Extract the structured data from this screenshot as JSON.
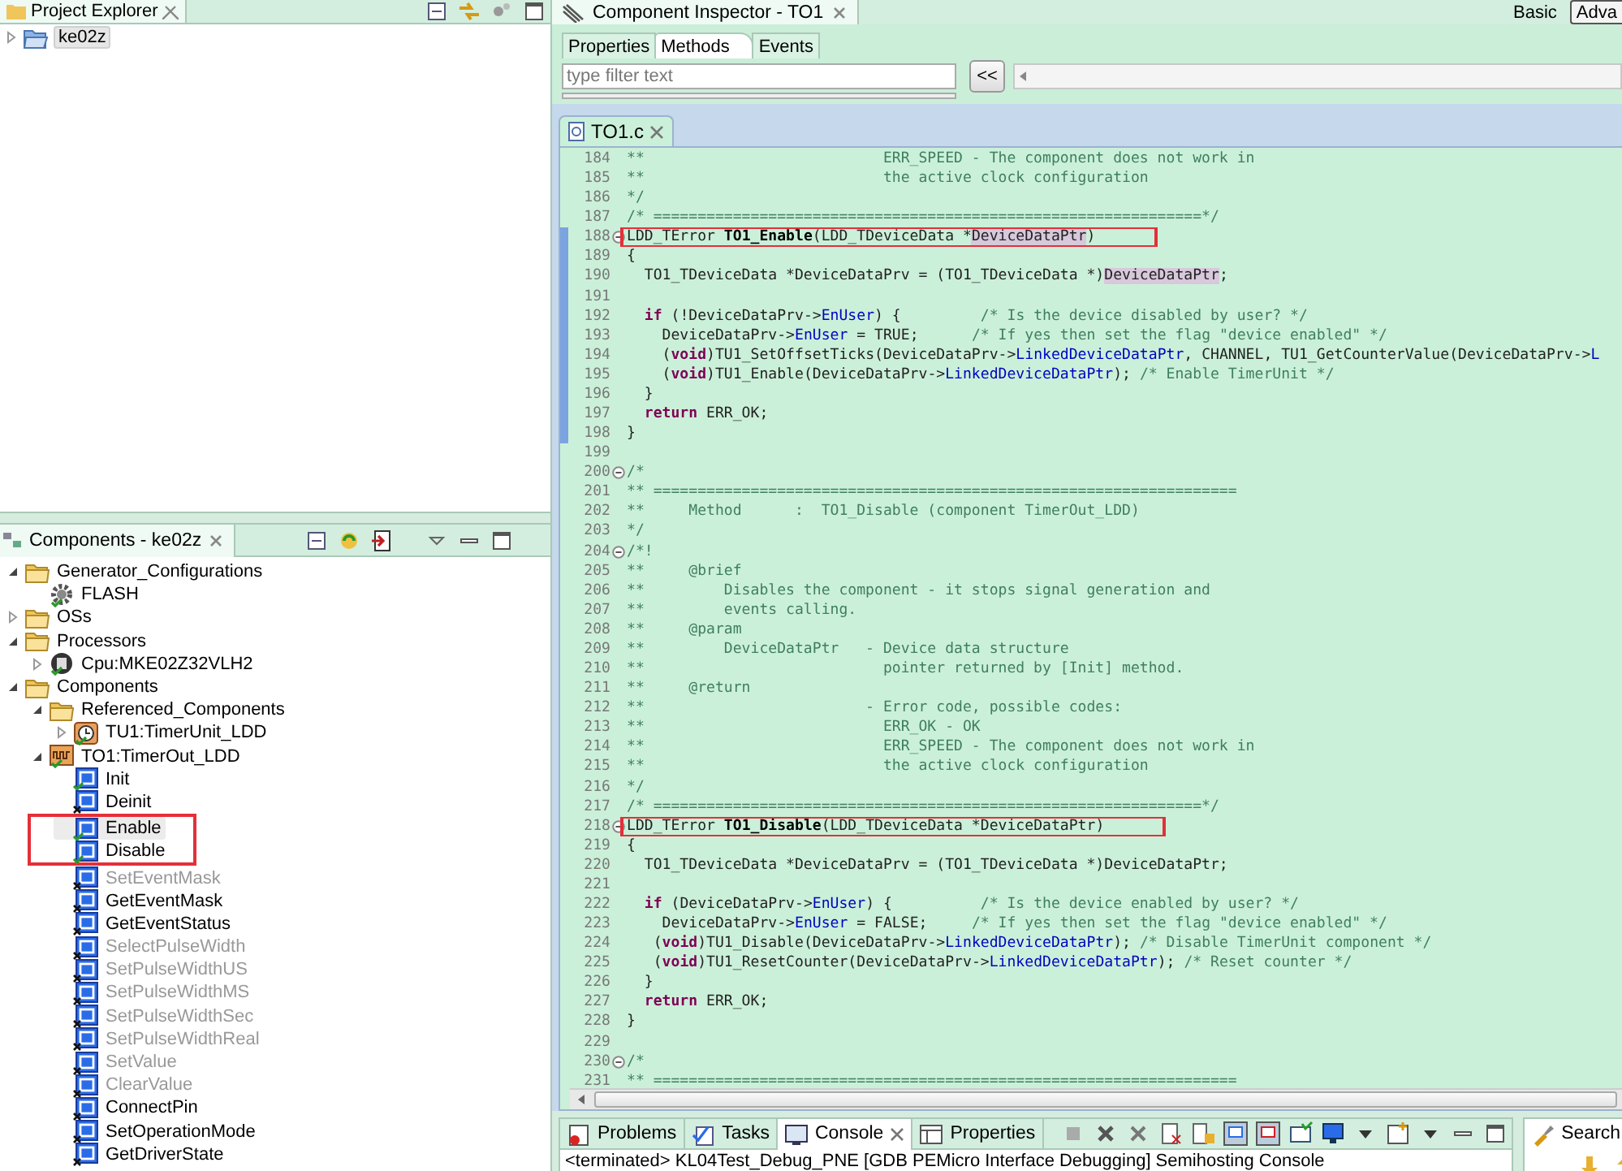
{
  "project_explorer": {
    "title": "Project Explorer",
    "items": [
      {
        "label": "ke02z",
        "kind": "project",
        "expanded": false,
        "selected": true
      }
    ]
  },
  "components": {
    "title": "Components - ke02z",
    "tree": [
      {
        "label": "Generator_Configurations",
        "kind": "folder",
        "expanded": true,
        "selected": false,
        "children": [
          {
            "label": "FLASH",
            "kind": "gear",
            "selected": false
          }
        ]
      },
      {
        "label": "OSs",
        "kind": "folder",
        "expanded": false,
        "selected": false
      },
      {
        "label": "Processors",
        "kind": "folder",
        "expanded": true,
        "selected": false,
        "children": [
          {
            "label": "Cpu:MKE02Z32VLH2",
            "kind": "cpu",
            "expanded": false,
            "selected": false
          }
        ]
      },
      {
        "label": "Components",
        "kind": "folder",
        "expanded": true,
        "selected": false,
        "children": [
          {
            "label": "Referenced_Components",
            "kind": "folder",
            "expanded": true,
            "selected": false,
            "children": [
              {
                "label": "TU1:TimerUnit_LDD",
                "kind": "timer",
                "expanded": false,
                "selected": false
              }
            ]
          },
          {
            "label": "TO1:TimerOut_LDD",
            "kind": "component",
            "expanded": true,
            "selected": false,
            "children": [
              {
                "label": "Init",
                "kind": "method",
                "generated": true,
                "disabled": false,
                "selected": false
              },
              {
                "label": "Deinit",
                "kind": "method",
                "generated": false,
                "disabled": false,
                "selected": false
              },
              {
                "label": "Enable",
                "kind": "method",
                "generated": true,
                "disabled": false,
                "selected": true,
                "marked": true
              },
              {
                "label": "Disable",
                "kind": "method",
                "generated": true,
                "disabled": false,
                "selected": false,
                "marked": true
              },
              {
                "label": "SetEventMask",
                "kind": "method",
                "generated": false,
                "disabled": true,
                "selected": false
              },
              {
                "label": "GetEventMask",
                "kind": "method",
                "generated": false,
                "disabled": false,
                "selected": false
              },
              {
                "label": "GetEventStatus",
                "kind": "method",
                "generated": false,
                "disabled": false,
                "selected": false
              },
              {
                "label": "SelectPulseWidth",
                "kind": "method",
                "generated": false,
                "disabled": true,
                "selected": false
              },
              {
                "label": "SetPulseWidthUS",
                "kind": "method",
                "generated": false,
                "disabled": true,
                "selected": false
              },
              {
                "label": "SetPulseWidthMS",
                "kind": "method",
                "generated": false,
                "disabled": true,
                "selected": false
              },
              {
                "label": "SetPulseWidthSec",
                "kind": "method",
                "generated": false,
                "disabled": true,
                "selected": false
              },
              {
                "label": "SetPulseWidthReal",
                "kind": "method",
                "generated": false,
                "disabled": true,
                "selected": false
              },
              {
                "label": "SetValue",
                "kind": "method",
                "generated": false,
                "disabled": true,
                "selected": false
              },
              {
                "label": "ClearValue",
                "kind": "method",
                "generated": false,
                "disabled": true,
                "selected": false
              },
              {
                "label": "ConnectPin",
                "kind": "method",
                "generated": false,
                "disabled": false,
                "selected": false
              },
              {
                "label": "SetOperationMode",
                "kind": "method",
                "generated": false,
                "disabled": false,
                "selected": false
              },
              {
                "label": "GetDriverState",
                "kind": "method",
                "generated": false,
                "disabled": false,
                "selected": false
              }
            ]
          }
        ]
      }
    ]
  },
  "component_inspector": {
    "title": "Component Inspector - TO1",
    "modes": [
      {
        "label": "Basic",
        "selected": false
      },
      {
        "label": "Adva",
        "selected": true
      }
    ],
    "tabs": [
      {
        "label": "Properties",
        "selected": false
      },
      {
        "label": "Methods",
        "selected": true
      },
      {
        "label": "Events",
        "selected": false
      }
    ],
    "filter": {
      "placeholder": "type filter text"
    },
    "collapse_button": "<<"
  },
  "editor": {
    "tabs": [
      {
        "label": "TO1.c",
        "selected": true
      }
    ],
    "lines": [
      {
        "n": "184",
        "segs": [
          {
            "kind": "comment",
            "text": "**                           ERR_SPEED - The component does not work in"
          }
        ]
      },
      {
        "n": "185",
        "segs": [
          {
            "kind": "comment",
            "text": "**                           the active clock configuration"
          }
        ]
      },
      {
        "n": "186",
        "segs": [
          {
            "kind": "comment",
            "text": "*/"
          }
        ]
      },
      {
        "n": "187",
        "segs": [
          {
            "kind": "comment",
            "text": "/* ==============================================================*/"
          }
        ]
      },
      {
        "n": "188",
        "fold": true,
        "ruler": true,
        "marked": true,
        "segs": [
          {
            "kind": "plain",
            "text": "LDD_TError "
          },
          {
            "kind": "bold",
            "text": "TO1_Enable"
          },
          {
            "kind": "plain",
            "text": "(LDD_TDeviceData *"
          },
          {
            "kind": "occurrence",
            "text": "DeviceDataPtr"
          },
          {
            "kind": "plain",
            "text": ")"
          }
        ]
      },
      {
        "n": "189",
        "ruler": true,
        "segs": [
          {
            "kind": "plain",
            "text": "{"
          }
        ]
      },
      {
        "n": "190",
        "ruler": true,
        "segs": [
          {
            "kind": "plain",
            "text": "  TO1_TDeviceData *DeviceDataPrv = (TO1_TDeviceData *)"
          },
          {
            "kind": "occurrence",
            "text": "DeviceDataPtr"
          },
          {
            "kind": "plain",
            "text": ";"
          }
        ]
      },
      {
        "n": "191",
        "ruler": true
      },
      {
        "n": "192",
        "ruler": true,
        "segs": [
          {
            "kind": "keyword",
            "text": "  if"
          },
          {
            "kind": "plain",
            "text": " (!DeviceDataPrv->"
          },
          {
            "kind": "field",
            "text": "EnUser"
          },
          {
            "kind": "plain",
            "text": ") {         "
          },
          {
            "kind": "comment",
            "text": "/* Is the device disabled by user? */"
          }
        ]
      },
      {
        "n": "193",
        "ruler": true,
        "segs": [
          {
            "kind": "plain",
            "text": "    DeviceDataPrv->"
          },
          {
            "kind": "field",
            "text": "EnUser"
          },
          {
            "kind": "plain",
            "text": " = TRUE;      "
          },
          {
            "kind": "comment",
            "text": "/* If yes then set the flag \"device enabled\" */"
          }
        ]
      },
      {
        "n": "194",
        "ruler": true,
        "segs": [
          {
            "kind": "plain",
            "text": "    ("
          },
          {
            "kind": "keyword",
            "text": "void"
          },
          {
            "kind": "plain",
            "text": ")TU1_SetOffsetTicks(DeviceDataPrv->"
          },
          {
            "kind": "field",
            "text": "LinkedDeviceDataPtr"
          },
          {
            "kind": "plain",
            "text": ", CHANNEL, TU1_GetCounterValue(DeviceDataPrv->"
          },
          {
            "kind": "field",
            "text": "L"
          }
        ]
      },
      {
        "n": "195",
        "ruler": true,
        "segs": [
          {
            "kind": "plain",
            "text": "    ("
          },
          {
            "kind": "keyword",
            "text": "void"
          },
          {
            "kind": "plain",
            "text": ")TU1_Enable(DeviceDataPrv->"
          },
          {
            "kind": "field",
            "text": "LinkedDeviceDataPtr"
          },
          {
            "kind": "plain",
            "text": "); "
          },
          {
            "kind": "comment",
            "text": "/* Enable TimerUnit */"
          }
        ]
      },
      {
        "n": "196",
        "ruler": true,
        "segs": [
          {
            "kind": "plain",
            "text": "  }"
          }
        ]
      },
      {
        "n": "197",
        "ruler": true,
        "segs": [
          {
            "kind": "keyword",
            "text": "  return"
          },
          {
            "kind": "plain",
            "text": " ERR_OK;"
          }
        ]
      },
      {
        "n": "198",
        "ruler": true,
        "segs": [
          {
            "kind": "plain",
            "text": "}"
          }
        ]
      },
      {
        "n": "199"
      },
      {
        "n": "200",
        "fold": true,
        "segs": [
          {
            "kind": "comment",
            "text": "/*"
          }
        ]
      },
      {
        "n": "201",
        "segs": [
          {
            "kind": "comment",
            "text": "** =================================================================="
          }
        ]
      },
      {
        "n": "202",
        "segs": [
          {
            "kind": "comment",
            "text": "**     Method      :  TO1_Disable (component TimerOut_LDD)"
          }
        ]
      },
      {
        "n": "203",
        "segs": [
          {
            "kind": "comment",
            "text": "*/"
          }
        ]
      },
      {
        "n": "204",
        "fold": true,
        "segs": [
          {
            "kind": "comment",
            "text": "/*!"
          }
        ]
      },
      {
        "n": "205",
        "segs": [
          {
            "kind": "comment",
            "text": "**     @brief"
          }
        ]
      },
      {
        "n": "206",
        "segs": [
          {
            "kind": "comment",
            "text": "**         Disables the component - it stops signal generation and"
          }
        ]
      },
      {
        "n": "207",
        "segs": [
          {
            "kind": "comment",
            "text": "**         events calling."
          }
        ]
      },
      {
        "n": "208",
        "segs": [
          {
            "kind": "comment",
            "text": "**     @param"
          }
        ]
      },
      {
        "n": "209",
        "segs": [
          {
            "kind": "comment",
            "text": "**         DeviceDataPtr   - Device data structure"
          }
        ]
      },
      {
        "n": "210",
        "segs": [
          {
            "kind": "comment",
            "text": "**                           pointer returned by [Init] method."
          }
        ]
      },
      {
        "n": "211",
        "segs": [
          {
            "kind": "comment",
            "text": "**     @return"
          }
        ]
      },
      {
        "n": "212",
        "segs": [
          {
            "kind": "comment",
            "text": "**                         - Error code, possible codes:"
          }
        ]
      },
      {
        "n": "213",
        "segs": [
          {
            "kind": "comment",
            "text": "**                           ERR_OK - OK"
          }
        ]
      },
      {
        "n": "214",
        "segs": [
          {
            "kind": "comment",
            "text": "**                           ERR_SPEED - The component does not work in"
          }
        ]
      },
      {
        "n": "215",
        "segs": [
          {
            "kind": "comment",
            "text": "**                           the active clock configuration"
          }
        ]
      },
      {
        "n": "216",
        "segs": [
          {
            "kind": "comment",
            "text": "*/"
          }
        ]
      },
      {
        "n": "217",
        "segs": [
          {
            "kind": "comment",
            "text": "/* ==============================================================*/"
          }
        ]
      },
      {
        "n": "218",
        "fold": true,
        "marked": true,
        "segs": [
          {
            "kind": "plain",
            "text": "LDD_TError "
          },
          {
            "kind": "bold",
            "text": "TO1_Disable"
          },
          {
            "kind": "plain",
            "text": "(LDD_TDeviceData *DeviceDataPtr)"
          }
        ]
      },
      {
        "n": "219",
        "segs": [
          {
            "kind": "plain",
            "text": "{"
          }
        ]
      },
      {
        "n": "220",
        "segs": [
          {
            "kind": "plain",
            "text": "  TO1_TDeviceData *DeviceDataPrv = (TO1_TDeviceData *)DeviceDataPtr;"
          }
        ]
      },
      {
        "n": "221"
      },
      {
        "n": "222",
        "segs": [
          {
            "kind": "keyword",
            "text": "  if"
          },
          {
            "kind": "plain",
            "text": " (DeviceDataPrv->"
          },
          {
            "kind": "field",
            "text": "EnUser"
          },
          {
            "kind": "plain",
            "text": ") {          "
          },
          {
            "kind": "comment",
            "text": "/* Is the device enabled by user? */"
          }
        ]
      },
      {
        "n": "223",
        "segs": [
          {
            "kind": "plain",
            "text": "    DeviceDataPrv->"
          },
          {
            "kind": "field",
            "text": "EnUser"
          },
          {
            "kind": "plain",
            "text": " = FALSE;     "
          },
          {
            "kind": "comment",
            "text": "/* If yes then set the flag \"device enabled\" */"
          }
        ]
      },
      {
        "n": "224",
        "segs": [
          {
            "kind": "plain",
            "text": "   ("
          },
          {
            "kind": "keyword",
            "text": "void"
          },
          {
            "kind": "plain",
            "text": ")TU1_Disable(DeviceDataPrv->"
          },
          {
            "kind": "field",
            "text": "LinkedDeviceDataPtr"
          },
          {
            "kind": "plain",
            "text": "); "
          },
          {
            "kind": "comment",
            "text": "/* Disable TimerUnit component */"
          }
        ]
      },
      {
        "n": "225",
        "segs": [
          {
            "kind": "plain",
            "text": "   ("
          },
          {
            "kind": "keyword",
            "text": "void"
          },
          {
            "kind": "plain",
            "text": ")TU1_ResetCounter(DeviceDataPrv->"
          },
          {
            "kind": "field",
            "text": "LinkedDeviceDataPtr"
          },
          {
            "kind": "plain",
            "text": "); "
          },
          {
            "kind": "comment",
            "text": "/* Reset counter */"
          }
        ]
      },
      {
        "n": "226",
        "segs": [
          {
            "kind": "plain",
            "text": "  }"
          }
        ]
      },
      {
        "n": "227",
        "segs": [
          {
            "kind": "keyword",
            "text": "  return"
          },
          {
            "kind": "plain",
            "text": " ERR_OK;"
          }
        ]
      },
      {
        "n": "228",
        "segs": [
          {
            "kind": "plain",
            "text": "}"
          }
        ]
      },
      {
        "n": "229"
      },
      {
        "n": "230",
        "fold": true,
        "segs": [
          {
            "kind": "comment",
            "text": "/*"
          }
        ]
      },
      {
        "n": "231",
        "segs": [
          {
            "kind": "comment",
            "text": "** =================================================================="
          }
        ]
      }
    ]
  },
  "bottom_panel": {
    "tabs": [
      {
        "label": "Problems",
        "kind": "problems",
        "selected": false
      },
      {
        "label": "Tasks",
        "kind": "tasks",
        "selected": false
      },
      {
        "label": "Console",
        "kind": "console",
        "selected": true
      },
      {
        "label": "Properties",
        "kind": "properties",
        "selected": false
      }
    ],
    "console_text": "<terminated> KL04Test_Debug_PNE [GDB PEMicro Interface Debugging] Semihosting Console"
  },
  "search_panel": {
    "tabs": [
      {
        "label": "Search",
        "selected": true
      }
    ]
  }
}
